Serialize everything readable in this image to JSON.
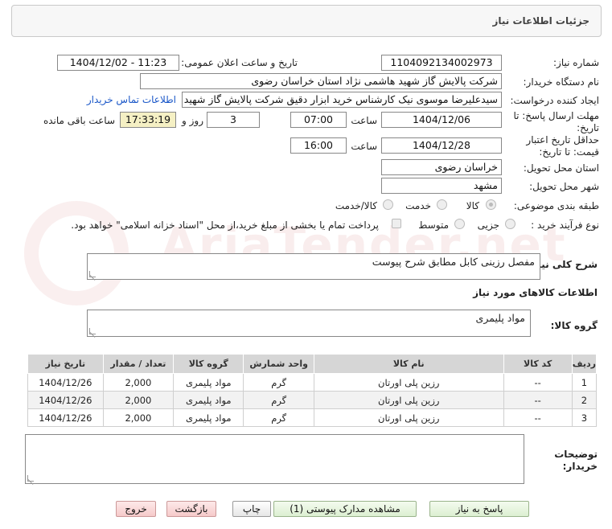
{
  "header": {
    "title": "جزئیات اطلاعات نیاز"
  },
  "form": {
    "need_number_label": "شماره نیاز:",
    "need_number": "1104092134002973",
    "announce_label": "تاریخ و ساعت اعلان عمومی:",
    "announce_value": "1404/12/02 - 11:23",
    "buyer_org_label": "نام دستگاه خریدار:",
    "buyer_org": "شرکت پالایش گاز شهید هاشمی نژاد   استان خراسان رضوی",
    "requester_label": "ایجاد کننده درخواست:",
    "requester": "سیدعلیرضا موسوی نیک کارشناس خرید ابزار دقیق شرکت پالایش گاز شهید هاشمی نژاد",
    "contact_link": "اطلاعات تماس خریدار",
    "deadline_label": "مهلت ارسال پاسخ: تا تاریخ:",
    "deadline_date": "1404/12/06",
    "time_label": "ساعت",
    "deadline_time": "07:00",
    "days_value": "3",
    "days_label": "روز و",
    "remaining_time": "17:33:19",
    "remaining_label": "ساعت باقی مانده",
    "validity_label": "حداقل تاریخ اعتبار قیمت: تا تاریخ:",
    "validity_date": "1404/12/28",
    "validity_time": "16:00",
    "province_label": "استان محل تحویل:",
    "province": "خراسان رضوی",
    "city_label": "شهر محل تحویل:",
    "city": "مشهد",
    "category_label": "طبقه بندی موضوعی:",
    "category_options": [
      "کالا",
      "خدمت",
      "کالا/خدمت"
    ],
    "category_selected": "کالا",
    "process_label": "نوع فرآیند خرید :",
    "process_options": [
      "جزیی",
      "متوسط"
    ],
    "payment_note": "پرداخت تمام یا بخشی از مبلغ خرید،از محل \"اسناد خزانه اسلامی\" خواهد بود.",
    "summary_label": "شرح کلی نیاز:",
    "summary": "مفصل رزینی کابل مطابق شرح پیوست",
    "goods_info_label": "اطلاعات کالاهای مورد نیاز",
    "goods_group_label": "گروه کالا:",
    "goods_group": "مواد پلیمری"
  },
  "table": {
    "headers": [
      "ردیف",
      "کد کالا",
      "نام کالا",
      "واحد شمارش",
      "گروه کالا",
      "تعداد / مقدار",
      "تاریخ نیاز"
    ],
    "rows": [
      [
        "1",
        "--",
        "رزین پلی اورتان",
        "گرم",
        "مواد پلیمری",
        "2,000",
        "1404/12/26"
      ],
      [
        "2",
        "--",
        "رزین پلی اورتان",
        "گرم",
        "مواد پلیمری",
        "2,000",
        "1404/12/26"
      ],
      [
        "3",
        "--",
        "رزین پلی اورتان",
        "گرم",
        "مواد پلیمری",
        "2,000",
        "1404/12/26"
      ]
    ]
  },
  "buyer_notes_label": "توضیحات خریدار:",
  "buttons": {
    "reply": "پاسخ به نیاز",
    "view_docs": "مشاهده مدارک پیوستی (1)",
    "print": "چاپ",
    "back": "بازگشت",
    "exit": "خروج"
  },
  "watermark": "AriaTender.net"
}
